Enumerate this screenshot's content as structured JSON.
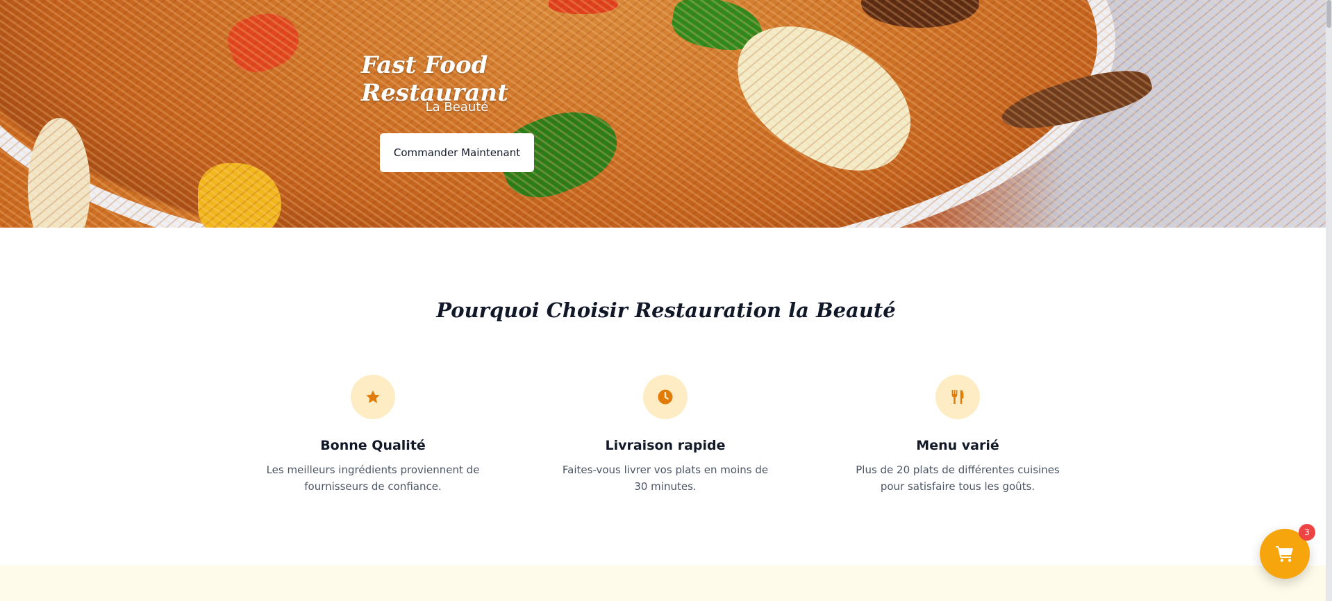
{
  "hero": {
    "title": "Fast Food Restaurant",
    "subtitle": "La Beauté",
    "cta_label": "Commander Maintenant"
  },
  "why": {
    "title": "Pourquoi Choisir Restauration la Beauté",
    "features": [
      {
        "icon": "star-icon",
        "title": "Bonne Qualité",
        "text": "Les meilleurs ingrédients proviennent de fournisseurs de confiance."
      },
      {
        "icon": "clock-icon",
        "title": "Livraison rapide",
        "text": "Faites-vous livrer vos plats en moins de 30 minutes."
      },
      {
        "icon": "utensils-icon",
        "title": "Menu varié",
        "text": "Plus de 20 plats de différentes cuisines pour satisfaire tous les goûts."
      }
    ]
  },
  "cart": {
    "icon": "cart-icon",
    "count": "3"
  },
  "colors": {
    "accent": "#f6a50c",
    "icon": "#e07c07",
    "icon_bg": "#fdecc4",
    "badge": "#ef4444",
    "band": "#fefbea"
  }
}
